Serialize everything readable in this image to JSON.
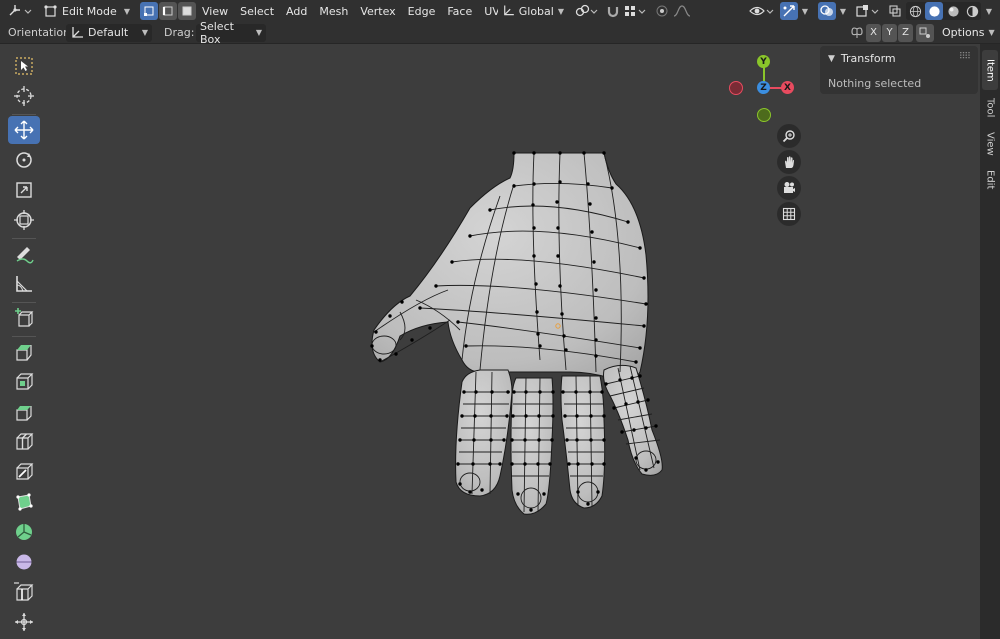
{
  "header": {
    "mode": "Edit Mode",
    "menus": [
      "View",
      "Select",
      "Add",
      "Mesh",
      "Vertex",
      "Edge",
      "Face",
      "UV"
    ],
    "transform_orientation": "Global",
    "options_label": "Options"
  },
  "tool_settings": {
    "orientation_label": "Orientation:",
    "orientation_value": "Default",
    "drag_label": "Drag:",
    "drag_value": "Select Box",
    "mirror_axes": [
      "X",
      "Y",
      "Z"
    ]
  },
  "gizmo": {
    "x": "X",
    "y": "Y",
    "z": "Z"
  },
  "sidebar": {
    "panel_title": "Transform",
    "message": "Nothing selected",
    "tabs": [
      "Item",
      "Tool",
      "View",
      "Edit"
    ],
    "active_tab": "Item"
  },
  "colors": {
    "accent": "#4772b3",
    "axis_x": "#e84b5f",
    "axis_y": "#8ac52a",
    "axis_z": "#3b8ee0",
    "mesh_surface": "#c8c8c8",
    "background": "#3d3d3d"
  }
}
